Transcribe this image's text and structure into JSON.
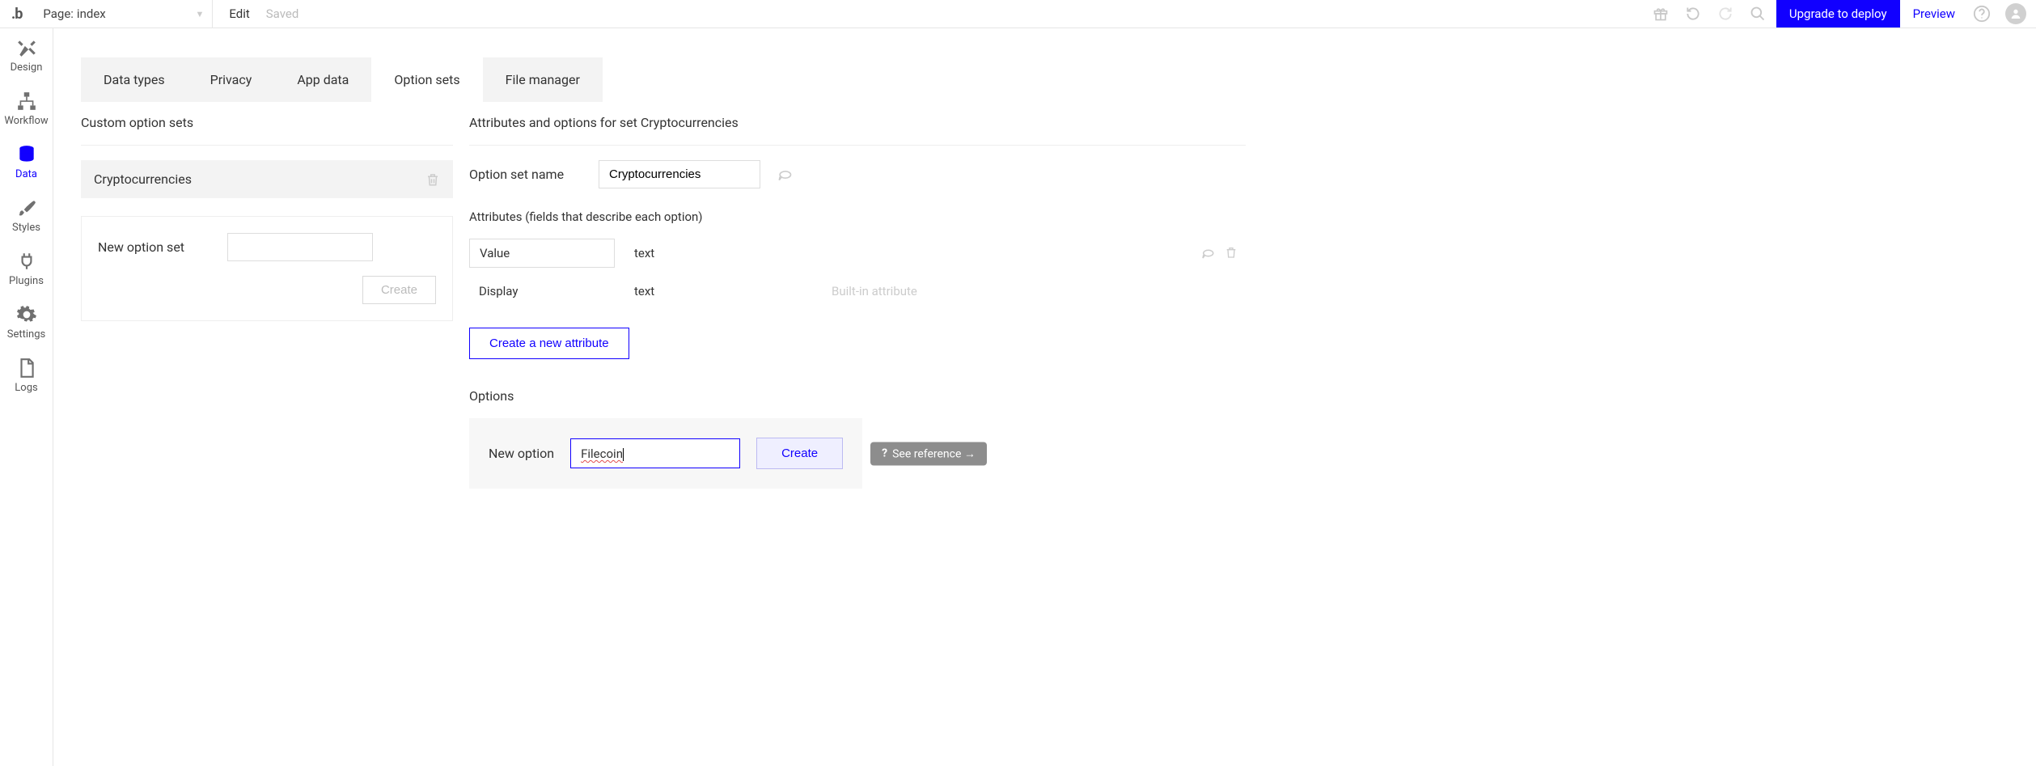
{
  "topbar": {
    "page_prefix": "Page: ",
    "page_name": "index",
    "edit": "Edit",
    "saved": "Saved",
    "upgrade": "Upgrade to deploy",
    "preview": "Preview"
  },
  "leftnav": [
    {
      "id": "design",
      "label": "Design"
    },
    {
      "id": "workflow",
      "label": "Workflow"
    },
    {
      "id": "data",
      "label": "Data"
    },
    {
      "id": "styles",
      "label": "Styles"
    },
    {
      "id": "plugins",
      "label": "Plugins"
    },
    {
      "id": "settings",
      "label": "Settings"
    },
    {
      "id": "logs",
      "label": "Logs"
    }
  ],
  "tabs": [
    {
      "id": "datatypes",
      "label": "Data types"
    },
    {
      "id": "privacy",
      "label": "Privacy"
    },
    {
      "id": "appdata",
      "label": "App data"
    },
    {
      "id": "optionsets",
      "label": "Option sets"
    },
    {
      "id": "filemgr",
      "label": "File manager"
    }
  ],
  "left_col": {
    "title": "Custom option sets",
    "set_name": "Cryptocurrencies",
    "new_set_label": "New option set",
    "new_set_value": "",
    "create_btn": "Create"
  },
  "right_col": {
    "title_prefix": "Attributes and options for set ",
    "title_set": "Cryptocurrencies",
    "name_label": "Option set name",
    "name_value": "Cryptocurrencies",
    "attrs_label": "Attributes (fields that describe each option)",
    "attributes": [
      {
        "name": "Value",
        "type": "text",
        "builtin": false
      },
      {
        "name": "Display",
        "type": "text",
        "builtin": true
      }
    ],
    "builtin_text": "Built-in attribute",
    "new_attr_btn": "Create a new attribute",
    "options_label": "Options",
    "new_option_label": "New option",
    "new_option_value": "Filecoin",
    "create_option_btn": "Create",
    "see_reference": "See reference →"
  }
}
